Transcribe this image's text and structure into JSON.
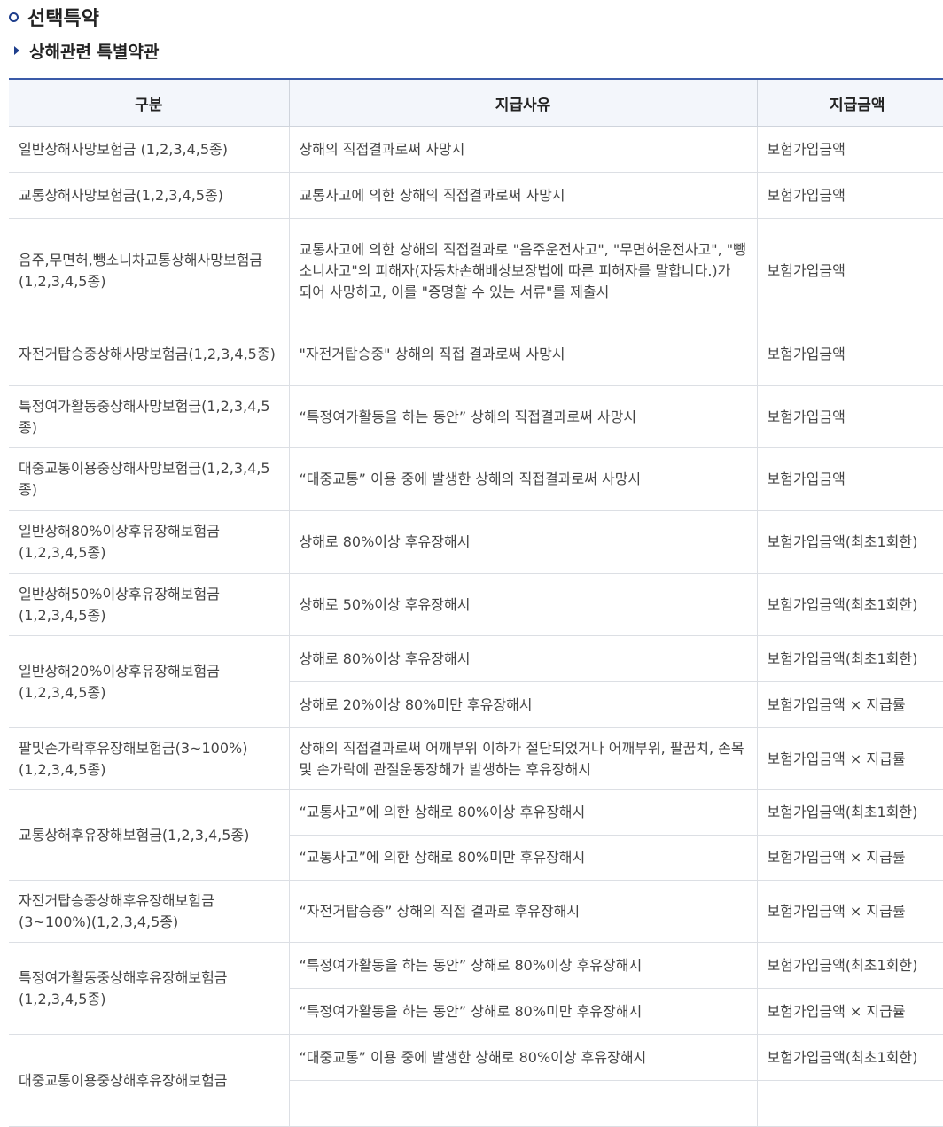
{
  "heading": {
    "title": "선택특약",
    "subtitle": "상해관련 특별약관"
  },
  "table": {
    "headers": [
      "구분",
      "지급사유",
      "지급금액"
    ],
    "groups": [
      {
        "name": "일반상해사망보험금 (1,2,3,4,5종)",
        "h": 52,
        "rows": [
          {
            "reason": "상해의 직접결과로써 사망시",
            "amount": "보험가입금액"
          }
        ]
      },
      {
        "name": "교통상해사망보험금(1,2,3,4,5종)",
        "h": 52,
        "rows": [
          {
            "reason": "교통사고에 의한 상해의 직접결과로써 사망시",
            "amount": "보험가입금액"
          }
        ]
      },
      {
        "name": "음주,무면허,뺑소니차교통상해사망보험금(1,2,3,4,5종)",
        "h": 118,
        "rows": [
          {
            "reason": "교통사고에 의한 상해의 직접결과로 \"음주운전사고\", \"무면허운전사고\", \"뺑소니사고\"의 피해자(자동차손해배상보장법에 따른 피해자를 말합니다.)가 되어 사망하고, 이를 \"증명할 수 있는 서류\"를 제출시",
            "amount": "보험가입금액"
          }
        ]
      },
      {
        "name": "자전거탑승중상해사망보험금(1,2,3,4,5종)",
        "h": 71,
        "rows": [
          {
            "reason": "\"자전거탑승중\" 상해의 직접 결과로써 사망시",
            "amount": "보험가입금액"
          }
        ]
      },
      {
        "name": "특정여가활동중상해사망보험금(1,2,3,4,5종)",
        "h": 70,
        "rows": [
          {
            "reason": "“특정여가활동을 하는 동안” 상해의 직접결과로써 사망시",
            "amount": "보험가입금액"
          }
        ]
      },
      {
        "name": "대중교통이용중상해사망보험금(1,2,3,4,5종)",
        "h": 71,
        "rows": [
          {
            "reason": "“대중교통” 이용 중에 발생한 상해의 직접결과로써 사망시",
            "amount": "보험가입금액"
          }
        ]
      },
      {
        "name": "일반상해80%이상후유장해보험금(1,2,3,4,5종)",
        "h": 71,
        "rows": [
          {
            "reason": "상해로 80%이상 후유장해시",
            "amount": "보험가입금액(최초1회한)"
          }
        ]
      },
      {
        "name": "일반상해50%이상후유장해보험금(1,2,3,4,5종)",
        "h": 70,
        "rows": [
          {
            "reason": "상해로 50%이상 후유장해시",
            "amount": "보험가입금액(최초1회한)"
          }
        ]
      },
      {
        "name": "일반상해20%이상후유장해보험금(1,2,3,4,5종)",
        "h": 52,
        "rows": [
          {
            "reason": "상해로 80%이상 후유장해시",
            "amount": "보험가입금액(최초1회한)"
          },
          {
            "reason": "상해로 20%이상 80%미만 후유장해시",
            "amount": "보험가입금액 × 지급률"
          }
        ]
      },
      {
        "name": "팔및손가락후유장해보험금(3~100%)(1,2,3,4,5종)",
        "h": 70,
        "rows": [
          {
            "reason": "상해의 직접결과로써 어깨부위 이하가 절단되었거나 어깨부위, 팔꿈치, 손목 및 손가락에 관절운동장해가 발생하는 후유장해시",
            "amount": "보험가입금액 × 지급률"
          }
        ]
      },
      {
        "name": "교통상해후유장해보험금(1,2,3,4,5종)",
        "h": 51,
        "rows": [
          {
            "reason": "“교통사고”에 의한 상해로 80%이상 후유장해시",
            "amount": "보험가입금액(최초1회한)"
          },
          {
            "reason": "“교통사고”에 의한 상해로 80%미만 후유장해시",
            "amount": "보험가입금액 × 지급률"
          }
        ]
      },
      {
        "name": "자전거탑승중상해후유장해보험금(3~100%)(1,2,3,4,5종)",
        "h": 70,
        "rows": [
          {
            "reason": "“자전거탑승중” 상해의 직접 결과로 후유장해시",
            "amount": "보험가입금액 × 지급률"
          }
        ]
      },
      {
        "name": "특정여가활동중상해후유장해보험금(1,2,3,4,5종)",
        "h": 52,
        "rows": [
          {
            "reason": "“특정여가활동을 하는 동안” 상해로 80%이상 후유장해시",
            "amount": "보험가입금액(최초1회한)"
          },
          {
            "reason": "“특정여가활동을 하는 동안” 상해로 80%미만 후유장해시",
            "amount": "보험가입금액 × 지급률"
          }
        ]
      },
      {
        "name": "대중교통이용중상해후유장해보험금",
        "h": 52,
        "rows": [
          {
            "reason": "“대중교통” 이용 중에 발생한 상해로 80%이상 후유장해시",
            "amount": "보험가입금액(최초1회한)"
          },
          {
            "reason": "",
            "amount": ""
          }
        ]
      }
    ]
  }
}
